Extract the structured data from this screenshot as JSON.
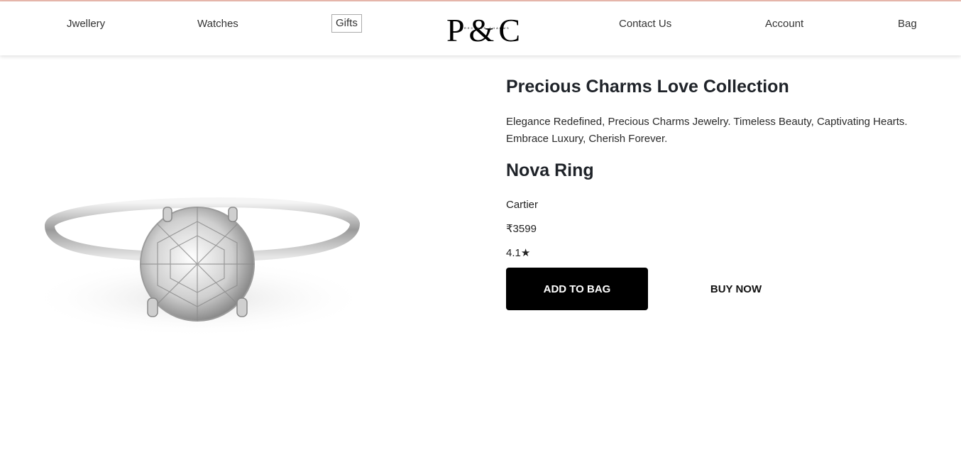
{
  "nav": {
    "items": [
      {
        "label": "Jwellery"
      },
      {
        "label": "Watches"
      },
      {
        "label": "Gifts"
      },
      {
        "label": "Contact Us"
      },
      {
        "label": "Account"
      },
      {
        "label": "Bag"
      }
    ],
    "logo_text": "P&C",
    "logo_subtext": "PRECIOUS CHARMS"
  },
  "product": {
    "collection_title": "Precious Charms Love Collection",
    "tagline": "Elegance Redefined, Precious Charms Jewelry. Timeless Beauty, Captivating Hearts. Embrace Luxury, Cherish Forever.",
    "name": "Nova Ring",
    "brand": "Cartier",
    "price": "₹3599",
    "rating": "4.1★",
    "image_icon": "diamond-ring-image"
  },
  "actions": {
    "add_to_bag": "ADD TO BAG",
    "buy_now": "BUY NOW"
  },
  "colors": {
    "accent_line": "#e9b8ad",
    "primary_button": "#000000",
    "text_dark": "#1f2329"
  }
}
